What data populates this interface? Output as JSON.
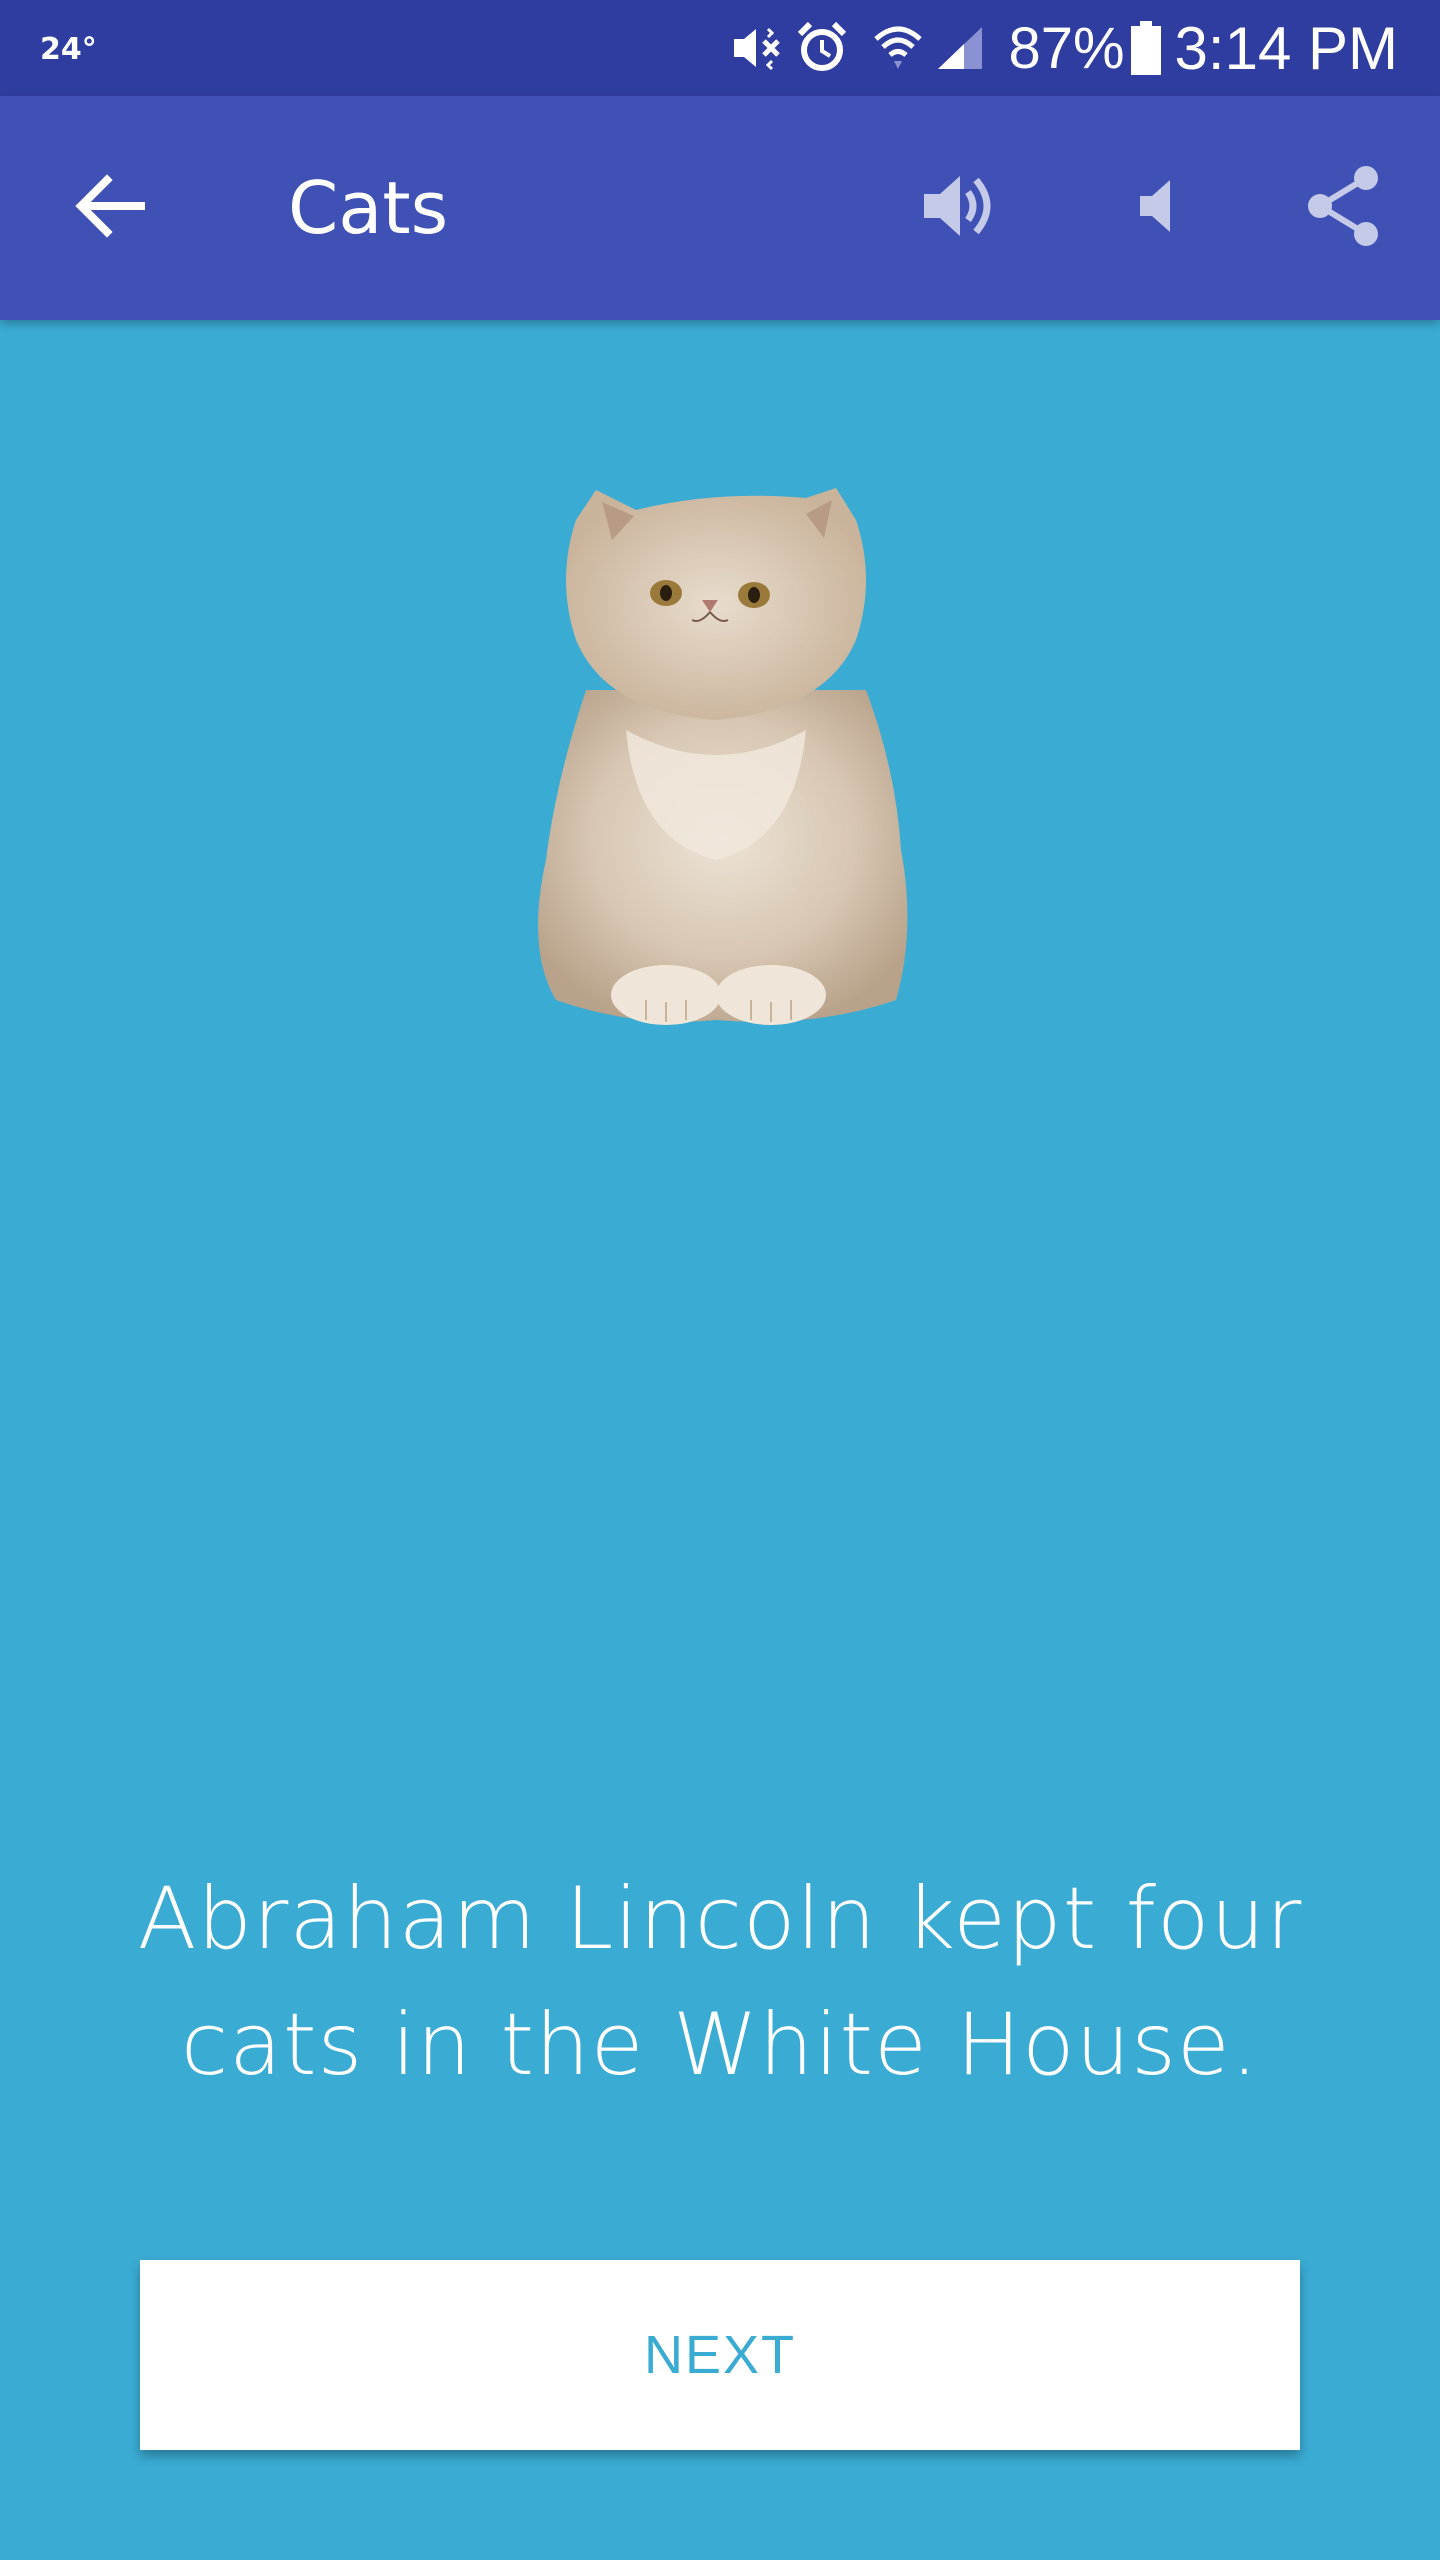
{
  "status_bar": {
    "temperature": "24°",
    "battery_percent": "87%",
    "time": "3:14 PM",
    "icons": [
      "vibrate-mute-icon",
      "alarm-icon",
      "wifi-icon",
      "signal-icon",
      "battery-icon"
    ]
  },
  "app_bar": {
    "title": "Cats",
    "back_icon": "arrow-back-icon",
    "actions": [
      "volume-up-icon",
      "volume-down-icon",
      "share-icon"
    ]
  },
  "content": {
    "image": "persian-cat-image",
    "fact": "Abraham Lincoln kept four cats in the White House.",
    "next_label": "NEXT"
  },
  "colors": {
    "status_bar": "#2f3da0",
    "app_bar": "#3f51b5",
    "background": "#3aabd3",
    "button_bg": "#ffffff",
    "button_text": "#3aabd3"
  }
}
